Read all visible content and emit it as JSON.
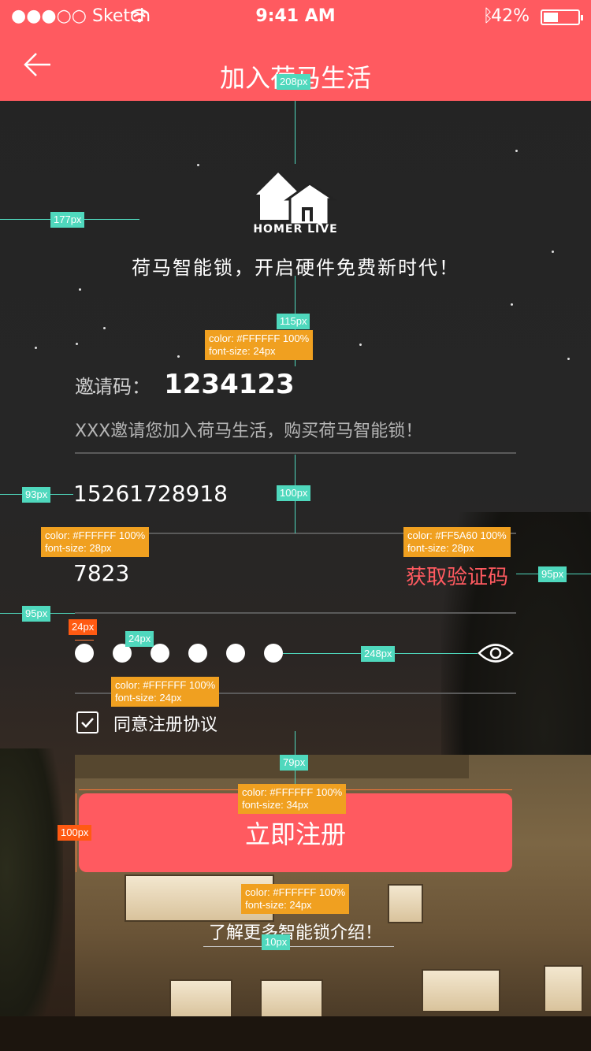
{
  "status_bar": {
    "carrier": "●●●○○ Sketch",
    "time": "9:41 AM",
    "battery": "42%",
    "icons": [
      "wifi-icon",
      "bluetooth-icon",
      "battery-icon"
    ]
  },
  "nav": {
    "title": "加入荷马生活",
    "back_icon": "arrow-left-icon"
  },
  "logo": {
    "icon": "house-logo-icon",
    "text": "HOMER LIVE"
  },
  "tagline": "荷马智能锁，开启硬件免费新时代！",
  "invite": {
    "label": "邀请码：",
    "code": "1234123",
    "message": "XXX邀请您加入荷马生活，购买荷马智能锁！"
  },
  "form": {
    "phone": "15261728918",
    "verification_code": "7823",
    "get_code_label": "获取验证码",
    "password_dots": 6,
    "eye_icon": "eye-icon",
    "agree_label": "同意注册协议",
    "agree_checked": true,
    "register_label": "立即注册",
    "more_link": "了解更多智能锁介绍！"
  },
  "colors": {
    "brand": "#FF5A60",
    "text": "#FFFFFF"
  },
  "annotations": {
    "a208": "208px",
    "a177": "177px",
    "a115": "115px",
    "spec_white_24_color": "color: #FFFFFF 100%",
    "spec_white_24_size": "font-size: 24px",
    "a93": "93px",
    "a100": "100px",
    "spec_white_28_color": "color: #FFFFFF 100%",
    "spec_white_28_size": "font-size: 28px",
    "spec_red_28_color": "color: #FF5A60 100%",
    "spec_red_28_size": "font-size: 28px",
    "a95r": "95px",
    "a95l": "95px",
    "a24o": "24px",
    "a24t": "24px",
    "a248": "248px",
    "spec_agree_color": "color: #FFFFFF 100%",
    "spec_agree_size": "font-size: 24px",
    "a79": "79px",
    "spec_btn_color": "color: #FFFFFF 100%",
    "spec_btn_size": "font-size: 34px",
    "a100btn": "100px",
    "spec_link_color": "color: #FFFFFF 100%",
    "spec_link_size": "font-size: 24px",
    "a10": "10px"
  }
}
